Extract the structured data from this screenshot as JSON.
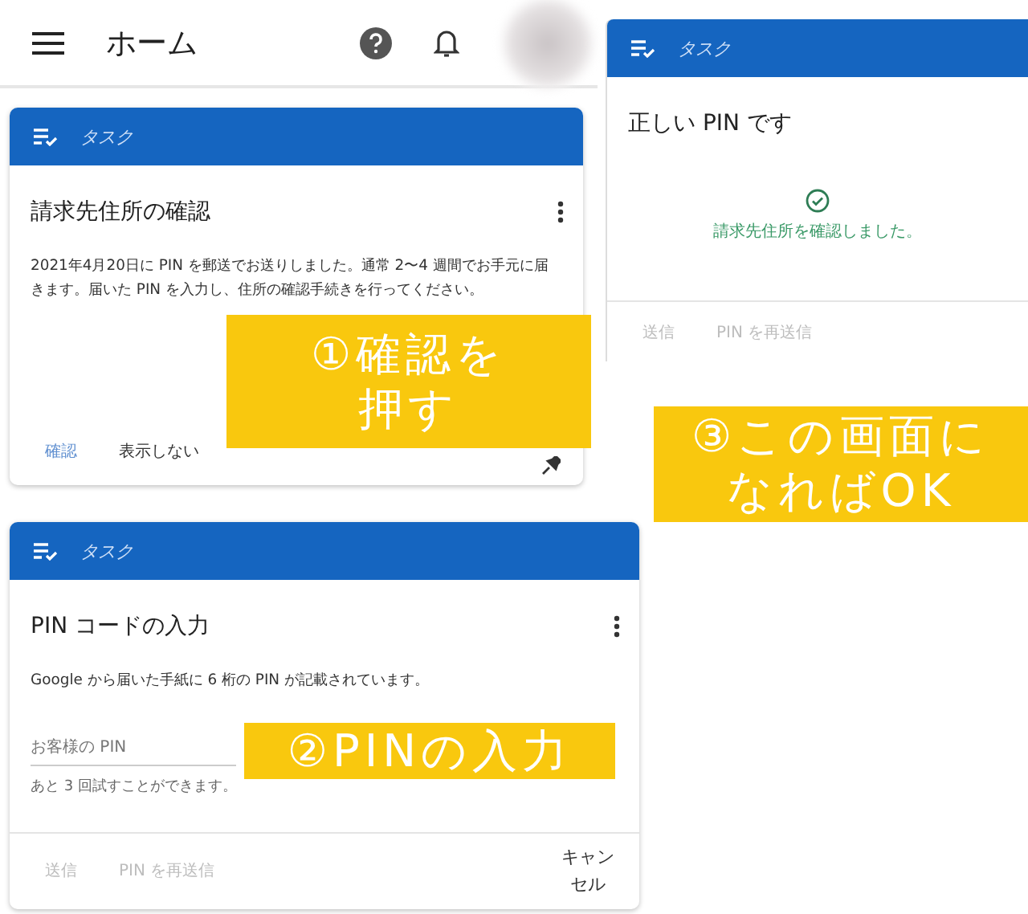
{
  "app_bar": {
    "title": "ホーム"
  },
  "cards": [
    {
      "header": "タスク",
      "title": "請求先住所の確認",
      "menu_button": true,
      "body": [
        {
          "kind": "text",
          "text": "2021年4月20日に PIN を郵送でお送りしました。通常 2〜4 週間でお手元に届きます。届いた PIN を入力し、住所の確認手続きを行ってください。"
        }
      ],
      "actions": [
        {
          "label": "確認",
          "disabled": false,
          "primary": true
        },
        {
          "label": "表示しない",
          "disabled": false,
          "primary": false
        }
      ],
      "pin_button": true
    },
    {
      "header": "タスク",
      "title": "正しい PIN です",
      "menu_button": false,
      "body": [
        {
          "kind": "success",
          "text": "請求先住所を確認しました。"
        }
      ],
      "actions": [
        {
          "label": "送信",
          "disabled": true
        },
        {
          "label": "PIN を再送信",
          "disabled": true
        }
      ],
      "pin_button": false
    },
    {
      "header": "タスク",
      "title": "PIN コードの入力",
      "menu_button": true,
      "body": [
        {
          "kind": "text",
          "text": "Google から届いた手紙に 6 桁の PIN が記載されています。"
        },
        {
          "kind": "field",
          "placeholder": "お客様の PIN",
          "hint": "あと 3 回試すことができます。"
        }
      ],
      "actions": [
        {
          "label": "送信",
          "disabled": true
        },
        {
          "label": "PIN を再送信",
          "disabled": true
        }
      ],
      "cancel": "キャンセル",
      "pin_button": false
    }
  ],
  "callouts": [
    {
      "lines": [
        "①確認を",
        "押す"
      ]
    },
    {
      "lines": [
        "②PINの入力"
      ]
    },
    {
      "lines": [
        "③この画面に",
        "なればOK"
      ]
    }
  ]
}
